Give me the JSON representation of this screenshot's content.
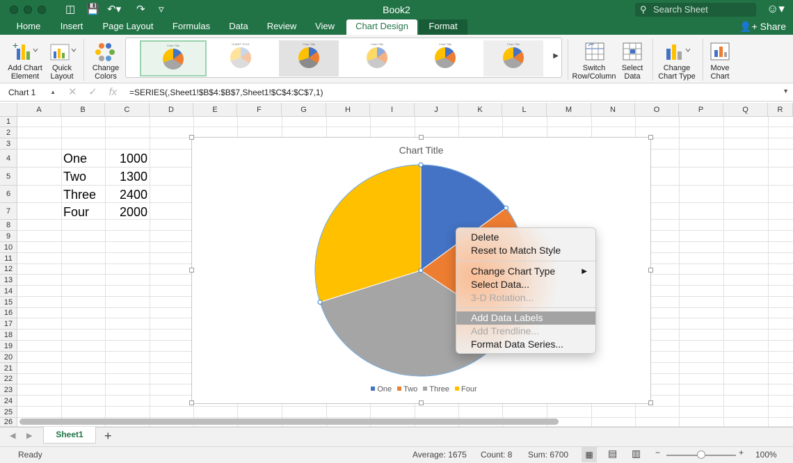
{
  "app": {
    "doc_title": "Book2",
    "search_placeholder": "Search Sheet",
    "share_label": "Share"
  },
  "tabs": [
    "Home",
    "Insert",
    "Page Layout",
    "Formulas",
    "Data",
    "Review",
    "View",
    "Chart Design",
    "Format"
  ],
  "ribbon": {
    "add_chart_element": [
      "Add Chart",
      "Element"
    ],
    "quick_layout": [
      "Quick",
      "Layout"
    ],
    "change_colors": [
      "Change",
      "Colors"
    ],
    "switch_row_column": [
      "Switch",
      "Row/Column"
    ],
    "select_data": [
      "Select",
      "Data"
    ],
    "change_chart_type": [
      "Change",
      "Chart Type"
    ],
    "move_chart": [
      "Move",
      "Chart"
    ],
    "gallery_item_title": "Chart Title",
    "gallery_item_title_caps": "CHART TITLE"
  },
  "formula_bar": {
    "name_box": "Chart 1",
    "formula": "=SERIES(,Sheet1!$B$4:$B$7,Sheet1!$C$4:$C$7,1)"
  },
  "columns": [
    "A",
    "B",
    "C",
    "D",
    "E",
    "F",
    "G",
    "H",
    "I",
    "J",
    "K",
    "L",
    "M",
    "N",
    "O",
    "P",
    "Q",
    "R"
  ],
  "rows": [
    "1",
    "2",
    "3",
    "4",
    "5",
    "6",
    "7",
    "8",
    "9",
    "10",
    "11",
    "12",
    "13",
    "14",
    "15",
    "16",
    "17",
    "18",
    "19",
    "20",
    "21",
    "22",
    "23",
    "24",
    "25",
    "26"
  ],
  "cells": [
    {
      "label": "One",
      "value": "1000"
    },
    {
      "label": "Two",
      "value": "1300"
    },
    {
      "label": "Three",
      "value": "2400"
    },
    {
      "label": "Four",
      "value": "2000"
    }
  ],
  "chart_data": {
    "type": "pie",
    "title": "Chart Title",
    "categories": [
      "One",
      "Two",
      "Three",
      "Four"
    ],
    "values": [
      1000,
      1300,
      2400,
      2000
    ],
    "colors": [
      "#4472c4",
      "#ed7d31",
      "#a5a5a5",
      "#ffc000"
    ],
    "legend": "bottom"
  },
  "context_menu": {
    "items": [
      "Delete",
      "Reset to Match Style",
      "Change Chart Type",
      "Select Data...",
      "3-D Rotation...",
      "Add Data Labels",
      "Add Trendline...",
      "Format Data Series..."
    ],
    "disabled": [
      "3-D Rotation...",
      "Add Trendline..."
    ],
    "highlighted": "Add Data Labels"
  },
  "sheets": {
    "active": "Sheet1",
    "add": "+"
  },
  "status": {
    "ready": "Ready",
    "average": "Average: 1675",
    "count": "Count: 8",
    "sum": "Sum: 6700",
    "zoom": "100%"
  }
}
